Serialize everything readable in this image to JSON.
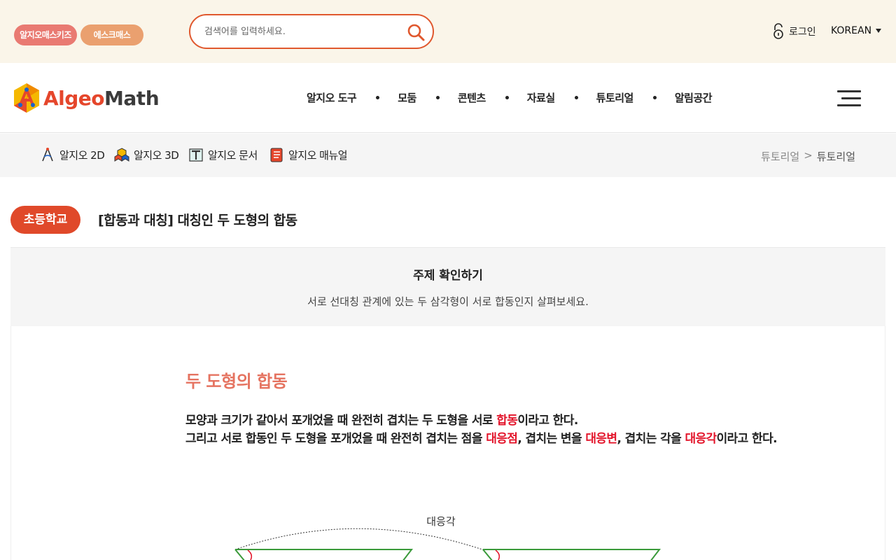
{
  "topbar": {
    "pill_kids": "알지오매스키즈",
    "pill_smath": "에스크매스",
    "search_placeholder": "검색어를 입력하세요.",
    "login": "로그인",
    "language": "KOREAN"
  },
  "nav": {
    "logo_brand_a": "Algeo",
    "logo_brand_b": "Math",
    "items": [
      "알지오 도구",
      "모둠",
      "콘텐츠",
      "자료실",
      "튜토리얼",
      "알림공간"
    ]
  },
  "subnav": {
    "tools": [
      "알지오 2D",
      "알지오 3D",
      "알지오 문서",
      "알지오 매뉴얼"
    ],
    "breadcrumb": [
      "튜토리얼",
      ">",
      "튜토리얼"
    ]
  },
  "page": {
    "level_badge": "초등학교",
    "title": "[합동과 대칭] 대칭인 두 도형의 합동"
  },
  "topic": {
    "heading": "주제 확인하기",
    "description": "서로 선대칭 관계에 있는 두 삼각형이 서로 합동인지 살펴보세요."
  },
  "content": {
    "heading": "두 도형의 합동",
    "line1_a": "모양과 크기가 같아서 포개었을 때 완전히 겹치는 두 도형을 서로 ",
    "line1_red": "합동",
    "line1_b": "이라고 한다.",
    "line2_a": "그리고 서로 합동인 두 도형을 포개었을 때 완전히 겹치는 점을 ",
    "line2_red1": "대응점",
    "line2_b": ", 겹치는 변을 ",
    "line2_red2": "대응변",
    "line2_c": ", 겹치는 각을 ",
    "line2_red3": "대응각",
    "line2_d": "이라고 한다.",
    "figure_label": "대응각"
  },
  "colors": {
    "accent": "#e0492a",
    "topbar_bg": "#faf5e9",
    "kids_pill": "#e97a72",
    "smath_pill": "#eaa06f",
    "heading": "#e57360",
    "highlight": "#e3142a",
    "shape_stroke": "#3a9a3a"
  }
}
